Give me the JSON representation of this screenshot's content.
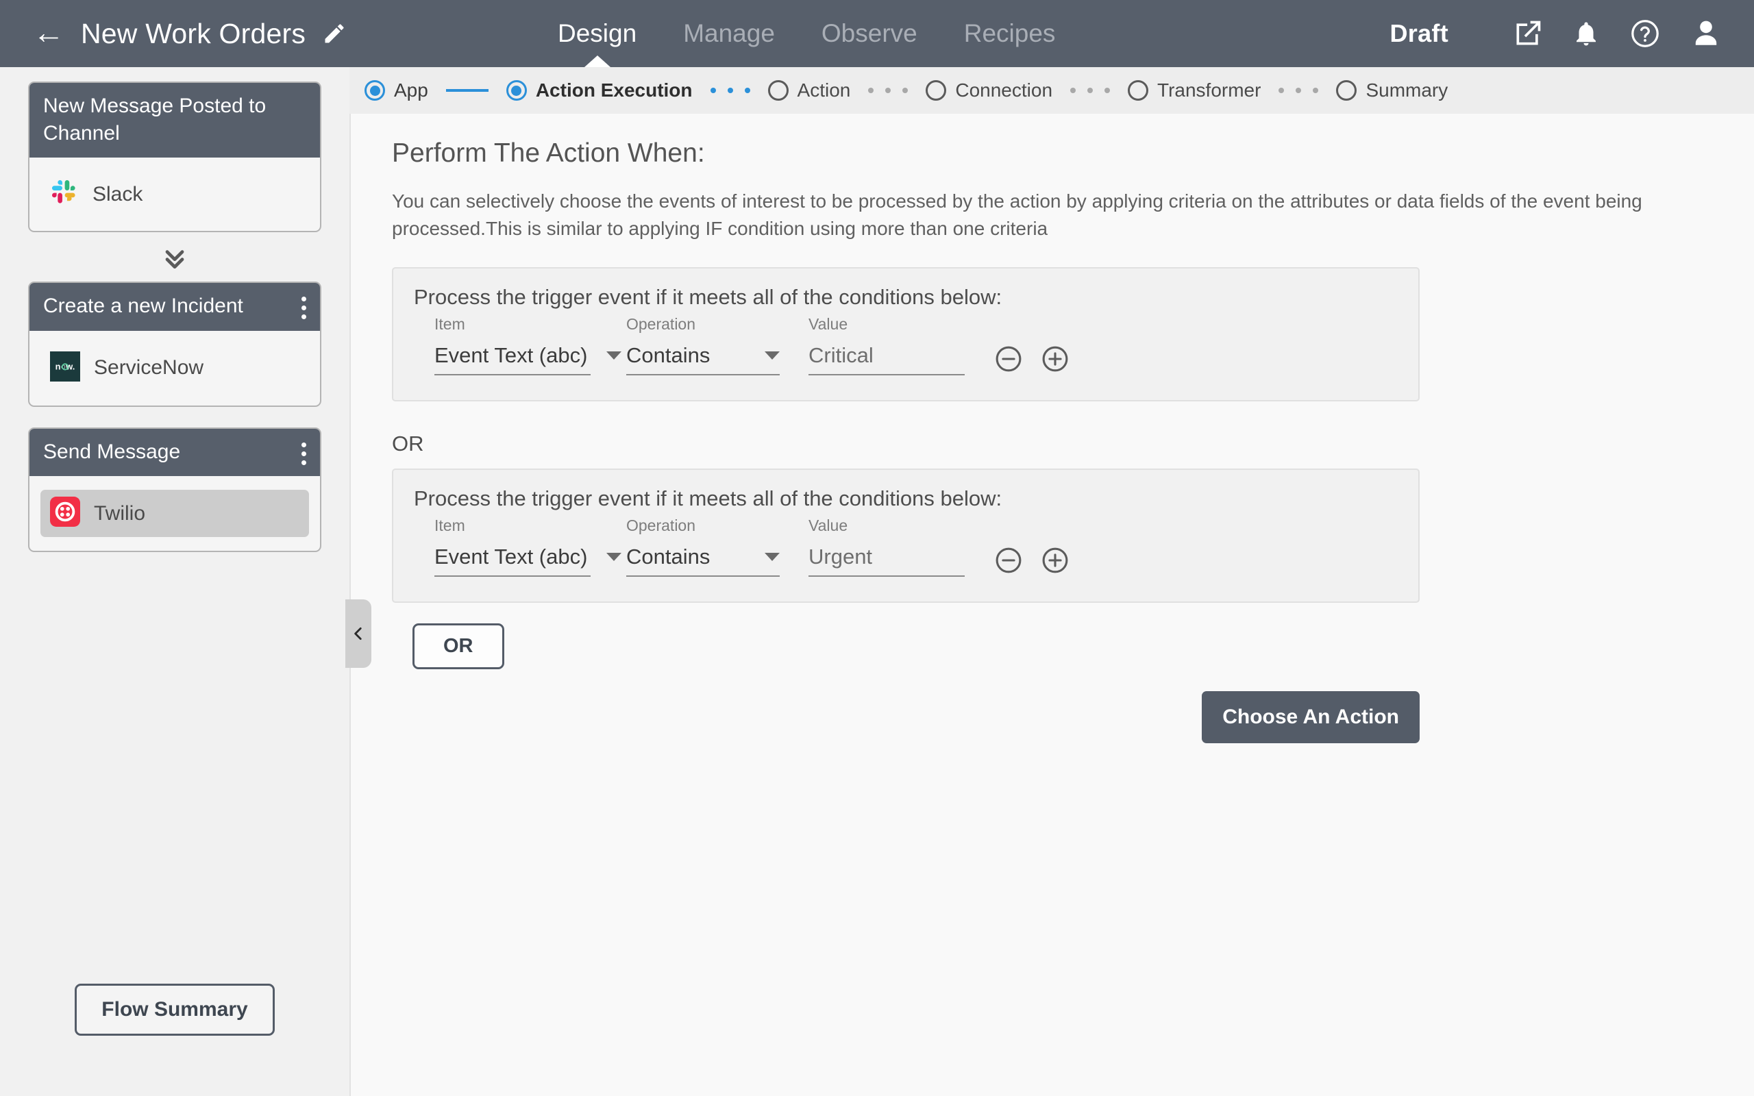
{
  "header": {
    "back_icon": "back-arrow-icon",
    "title": "New Work Orders",
    "edit_icon": "pencil-icon",
    "tabs": [
      {
        "label": "Design",
        "active": true
      },
      {
        "label": "Manage",
        "active": false
      },
      {
        "label": "Observe",
        "active": false
      },
      {
        "label": "Recipes",
        "active": false
      }
    ],
    "status": "Draft",
    "icons": [
      "external-link-icon",
      "bell-icon",
      "help-circle-icon",
      "user-avatar-icon"
    ],
    "bg_color": "#575f6b"
  },
  "stepper": {
    "accent_color": "#2b90d9",
    "steps": [
      {
        "label": "App",
        "state": "done"
      },
      {
        "label": "Action Execution",
        "state": "current"
      },
      {
        "label": "Action",
        "state": "pending"
      },
      {
        "label": "Connection",
        "state": "pending"
      },
      {
        "label": "Transformer",
        "state": "pending"
      },
      {
        "label": "Summary",
        "state": "pending"
      }
    ]
  },
  "sidebar": {
    "cards": [
      {
        "title": "New Message Posted to Channel",
        "app": "Slack",
        "app_icon": "slack-logo-icon",
        "selected": false,
        "has_menu": false
      },
      {
        "title": "Create a new Incident",
        "app": "ServiceNow",
        "app_icon": "servicenow-logo-icon",
        "selected": false,
        "has_menu": true
      },
      {
        "title": "Send Message",
        "app": "Twilio",
        "app_icon": "twilio-logo-icon",
        "selected": true,
        "has_menu": true
      }
    ],
    "expand_icon": "double-chevron-down-icon",
    "flow_summary_label": "Flow Summary",
    "collapse_icon": "chevron-left-icon"
  },
  "main": {
    "section_title": "Perform The Action When:",
    "section_desc": "You can selectively choose the events of interest to be processed by the action by applying criteria on the attributes or data fields of the event being processed.This is similar to applying IF condition using more than one criteria",
    "condition_groups": [
      {
        "heading": "Process the trigger event if it meets all of the conditions below:",
        "item_label": "Item",
        "item_value": "Event Text (abc)",
        "operation_label": "Operation",
        "operation_value": "Contains",
        "value_label": "Value",
        "value_value": "Critical",
        "remove_icon": "circle-minus-icon",
        "add_icon": "circle-plus-icon"
      },
      {
        "heading": "Process the trigger event if it meets all of the conditions below:",
        "item_label": "Item",
        "item_value": "Event Text (abc)",
        "operation_label": "Operation",
        "operation_value": "Contains",
        "value_label": "Value",
        "value_value": "Urgent",
        "remove_icon": "circle-minus-icon",
        "add_icon": "circle-plus-icon"
      }
    ],
    "or_separator": "OR",
    "or_button_label": "OR",
    "choose_action_label": "Choose An Action"
  }
}
